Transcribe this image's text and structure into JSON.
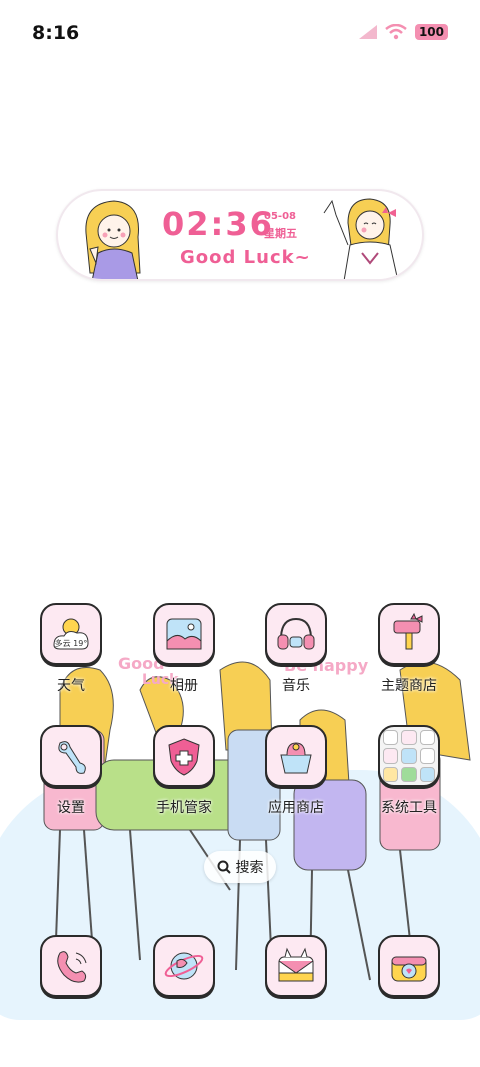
{
  "status_bar": {
    "time": "8:16",
    "battery": "100"
  },
  "widget": {
    "time": "02:36",
    "date": "05-08",
    "weekday": "星期五",
    "tagline": "Good Luck~"
  },
  "wallpaper": {
    "text_good": "Good",
    "text_luck": "Luck",
    "text_happy": "Be happy"
  },
  "apps_row1": [
    {
      "label": "天气",
      "weather_text": "多云 19°",
      "icon": "weather-icon"
    },
    {
      "label": "相册",
      "icon": "gallery-icon"
    },
    {
      "label": "音乐",
      "icon": "music-icon"
    },
    {
      "label": "主题商店",
      "icon": "theme-store-icon"
    }
  ],
  "apps_row2": [
    {
      "label": "设置",
      "icon": "settings-icon"
    },
    {
      "label": "手机管家",
      "icon": "phone-manager-icon"
    },
    {
      "label": "应用商店",
      "icon": "app-store-icon"
    },
    {
      "label": "系统工具",
      "icon": "system-tools-folder-icon"
    }
  ],
  "search": {
    "label": "搜索"
  },
  "dock": [
    {
      "icon": "phone-icon"
    },
    {
      "icon": "browser-icon"
    },
    {
      "icon": "messages-icon"
    },
    {
      "icon": "camera-icon"
    }
  ],
  "colors": {
    "accent": "#ef5f95",
    "icon_bg": "#fde9f2",
    "floor": "#e6f4fd"
  }
}
